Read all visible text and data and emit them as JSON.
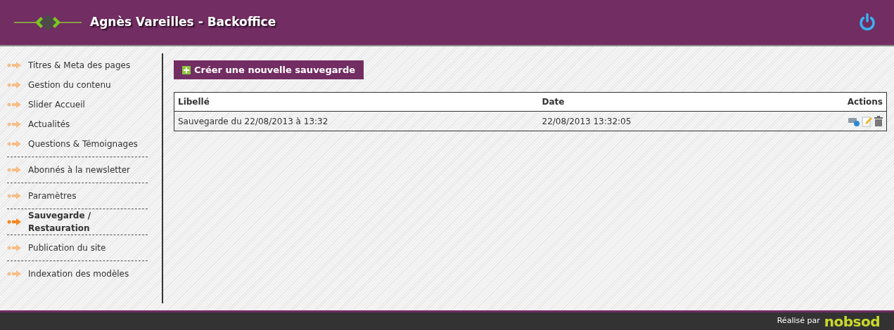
{
  "header": {
    "title": "Agnès Vareilles - Backoffice"
  },
  "sidebar": {
    "groups": [
      {
        "items": [
          {
            "label": "Titres & Meta des pages",
            "selected": false
          },
          {
            "label": "Gestion du contenu",
            "selected": false
          },
          {
            "label": "Slider Accueil",
            "selected": false
          },
          {
            "label": "Actualités",
            "selected": false
          },
          {
            "label": "Questions & Témoignages",
            "selected": false
          }
        ]
      },
      {
        "items": [
          {
            "label": "Abonnés à la newsletter",
            "selected": false
          }
        ]
      },
      {
        "items": [
          {
            "label": "Paramètres",
            "selected": false
          }
        ]
      },
      {
        "items": [
          {
            "label": "Sauvegarde / Restauration",
            "selected": true
          }
        ]
      },
      {
        "items": [
          {
            "label": "Publication du site",
            "selected": false
          }
        ]
      },
      {
        "items": [
          {
            "label": "Indexation des modèles",
            "selected": false
          }
        ]
      }
    ]
  },
  "create_button": {
    "label": "Créer une nouvelle sauvegarde"
  },
  "table": {
    "columns": [
      "Libellé",
      "Date",
      "Actions"
    ],
    "rows": [
      {
        "cells": [
          "Sauvegarde du 22/08/2013 à 13:32",
          "22/08/2013 13:32:05"
        ]
      }
    ]
  },
  "footer": {
    "text": "Réalisé par",
    "brand": "nobsod"
  }
}
